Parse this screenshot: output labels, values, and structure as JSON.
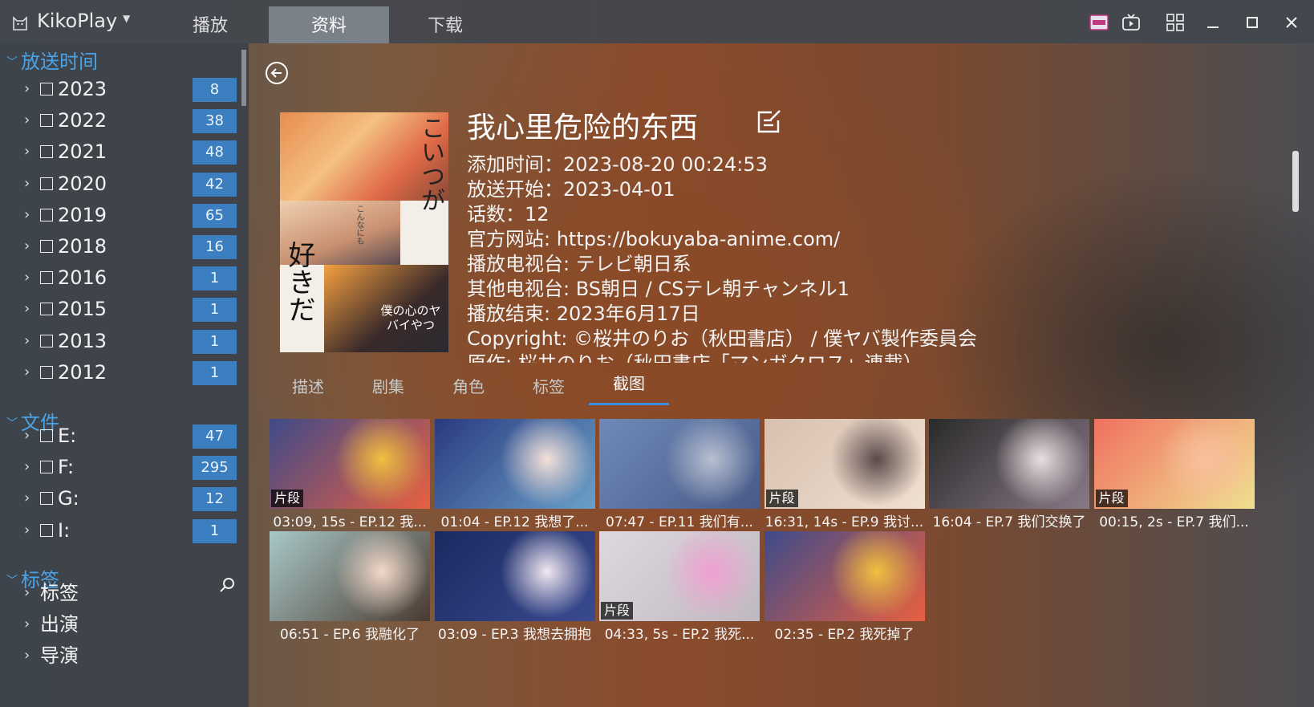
{
  "app": {
    "title": "KikoPlay",
    "menu_icon": "chevron-down",
    "logo_icon": "cat-app-icon"
  },
  "main_tabs": [
    {
      "label": "播放",
      "active": false
    },
    {
      "label": "资料",
      "active": true
    },
    {
      "label": "下载",
      "active": false
    }
  ],
  "window_buttons": [
    "danmaku-app-icon",
    "tv-icon",
    "grid-icon",
    "minimize-icon",
    "maximize-icon",
    "close-icon"
  ],
  "sidebar": {
    "airdate": {
      "title": "放送时间",
      "items": [
        {
          "label": "2023",
          "count": "8"
        },
        {
          "label": "2022",
          "count": "38"
        },
        {
          "label": "2021",
          "count": "48"
        },
        {
          "label": "2020",
          "count": "42"
        },
        {
          "label": "2019",
          "count": "65"
        },
        {
          "label": "2018",
          "count": "16"
        },
        {
          "label": "2016",
          "count": "1"
        },
        {
          "label": "2015",
          "count": "1"
        },
        {
          "label": "2013",
          "count": "1"
        },
        {
          "label": "2012",
          "count": "1"
        }
      ]
    },
    "files": {
      "title": "文件",
      "items": [
        {
          "label": "E:",
          "count": "47"
        },
        {
          "label": "F:",
          "count": "295"
        },
        {
          "label": "G:",
          "count": "12"
        },
        {
          "label": "I:",
          "count": "1"
        }
      ]
    },
    "tags": {
      "title": "标签",
      "items": [
        {
          "label": "标签"
        },
        {
          "label": "出演"
        },
        {
          "label": "导演"
        }
      ]
    }
  },
  "detail": {
    "title": "我心里危险的东西",
    "cover_text": {
      "vertical": "こいつが",
      "big": "好きだ",
      "small": "こんなにも",
      "logo": "僕の心のヤバイやつ"
    },
    "info_lines": [
      "添加时间：2023-08-20 00:24:53",
      "放送开始：2023-04-01",
      "话数：12",
      "官方网站: https://bokuyaba-anime.com/",
      "播放电视台: テレビ朝日系",
      "其他电视台: BS朝日 / CSテレ朝チャンネル1",
      "播放结束: 2023年6月17日",
      "Copyright: ©桜井のりお（秋田書店） / 僕ヤバ製作委員会",
      "原作: 桜井のりお（秋田書店「マンガクロス」連載）"
    ]
  },
  "sub_tabs": [
    {
      "label": "描述",
      "active": false
    },
    {
      "label": "剧集",
      "active": false
    },
    {
      "label": "角色",
      "active": false
    },
    {
      "label": "标签",
      "active": false
    },
    {
      "label": "截图",
      "active": true
    }
  ],
  "snapshots": [
    {
      "caption": "03:09, 15s - EP.12 我...",
      "badge": "片段",
      "palette": [
        "#3e4a8a",
        "#f0c040",
        "#e86040"
      ]
    },
    {
      "caption": "01:04 - EP.12 我想了...",
      "badge": "",
      "palette": [
        "#2a3a80",
        "#f4e0d8",
        "#6aa0c8"
      ]
    },
    {
      "caption": "07:47 - EP.11 我们有...",
      "badge": "",
      "palette": [
        "#6e8ab8",
        "#b8c0d0",
        "#4a5a88"
      ]
    },
    {
      "caption": "16:31, 14s - EP.9 我讨...",
      "badge": "片段",
      "palette": [
        "#d8c0b0",
        "#5a4a4a",
        "#f0e0d0"
      ]
    },
    {
      "caption": "16:04 - EP.7 我们交换了",
      "badge": "",
      "palette": [
        "#2a2a2a",
        "#e8e0e0",
        "#8a7a88"
      ]
    },
    {
      "caption": "00:15, 2s - EP.7 我们...",
      "badge": "片段",
      "palette": [
        "#f07060",
        "#f8c0a0",
        "#f0e090"
      ]
    },
    {
      "caption": "06:51 - EP.6 我融化了",
      "badge": "",
      "palette": [
        "#a8c8c8",
        "#f4d8c8",
        "#4a3a30"
      ]
    },
    {
      "caption": "03:09 - EP.3 我想去拥抱",
      "badge": "",
      "palette": [
        "#1a2a60",
        "#f0e8f0",
        "#3a4a90"
      ]
    },
    {
      "caption": "04:33, 5s - EP.2 我死...",
      "badge": "片段",
      "palette": [
        "#e0d8e0",
        "#f0a0d0",
        "#c0b8c0"
      ]
    },
    {
      "caption": "02:35 - EP.2 我死掉了",
      "badge": "",
      "palette": [
        "#3e4a8a",
        "#f0c040",
        "#e86040"
      ]
    }
  ]
}
